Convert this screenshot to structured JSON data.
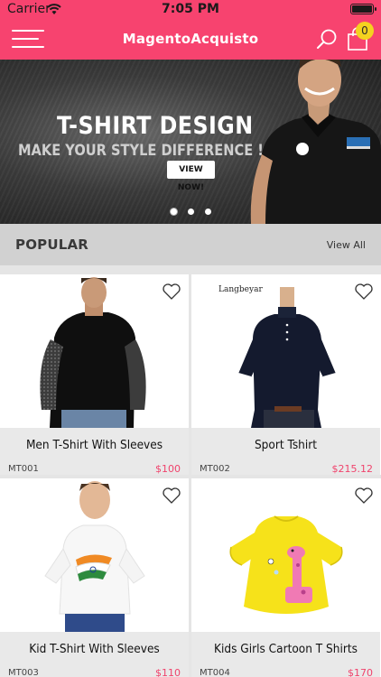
{
  "status_bar": {
    "carrier": "Carrier",
    "time": "7:05 PM"
  },
  "header": {
    "title": "MagentoAcquisto",
    "cart_count": "0",
    "icons": [
      "menu-icon",
      "search-icon",
      "cart-icon"
    ]
  },
  "banner": {
    "title": "T-SHIRT DESIGN",
    "subtitle": "MAKE YOUR STYLE DIFFERENCE !",
    "button_label": "VIEW NOW!",
    "slide_count": 3,
    "active_slide": 1
  },
  "popular": {
    "title": "POPULAR",
    "view_all_label": "View All"
  },
  "products": [
    {
      "name": "Men T-Shirt With Sleeves",
      "sku": "MT001",
      "price": "$100"
    },
    {
      "name": "Sport Tshirt",
      "sku": "MT002",
      "price": "$215.12",
      "brand": "Langbeyar"
    },
    {
      "name": "Kid T-Shirt With Sleeves",
      "sku": "MT003",
      "price": "$110"
    },
    {
      "name": "Kids Girls Cartoon T Shirts",
      "sku": "MT004",
      "price": "$170"
    }
  ],
  "colors": {
    "brand": "#f7436f",
    "badge": "#f4d21f",
    "price": "#f0436c",
    "section_bar": "#d1d1d1"
  }
}
